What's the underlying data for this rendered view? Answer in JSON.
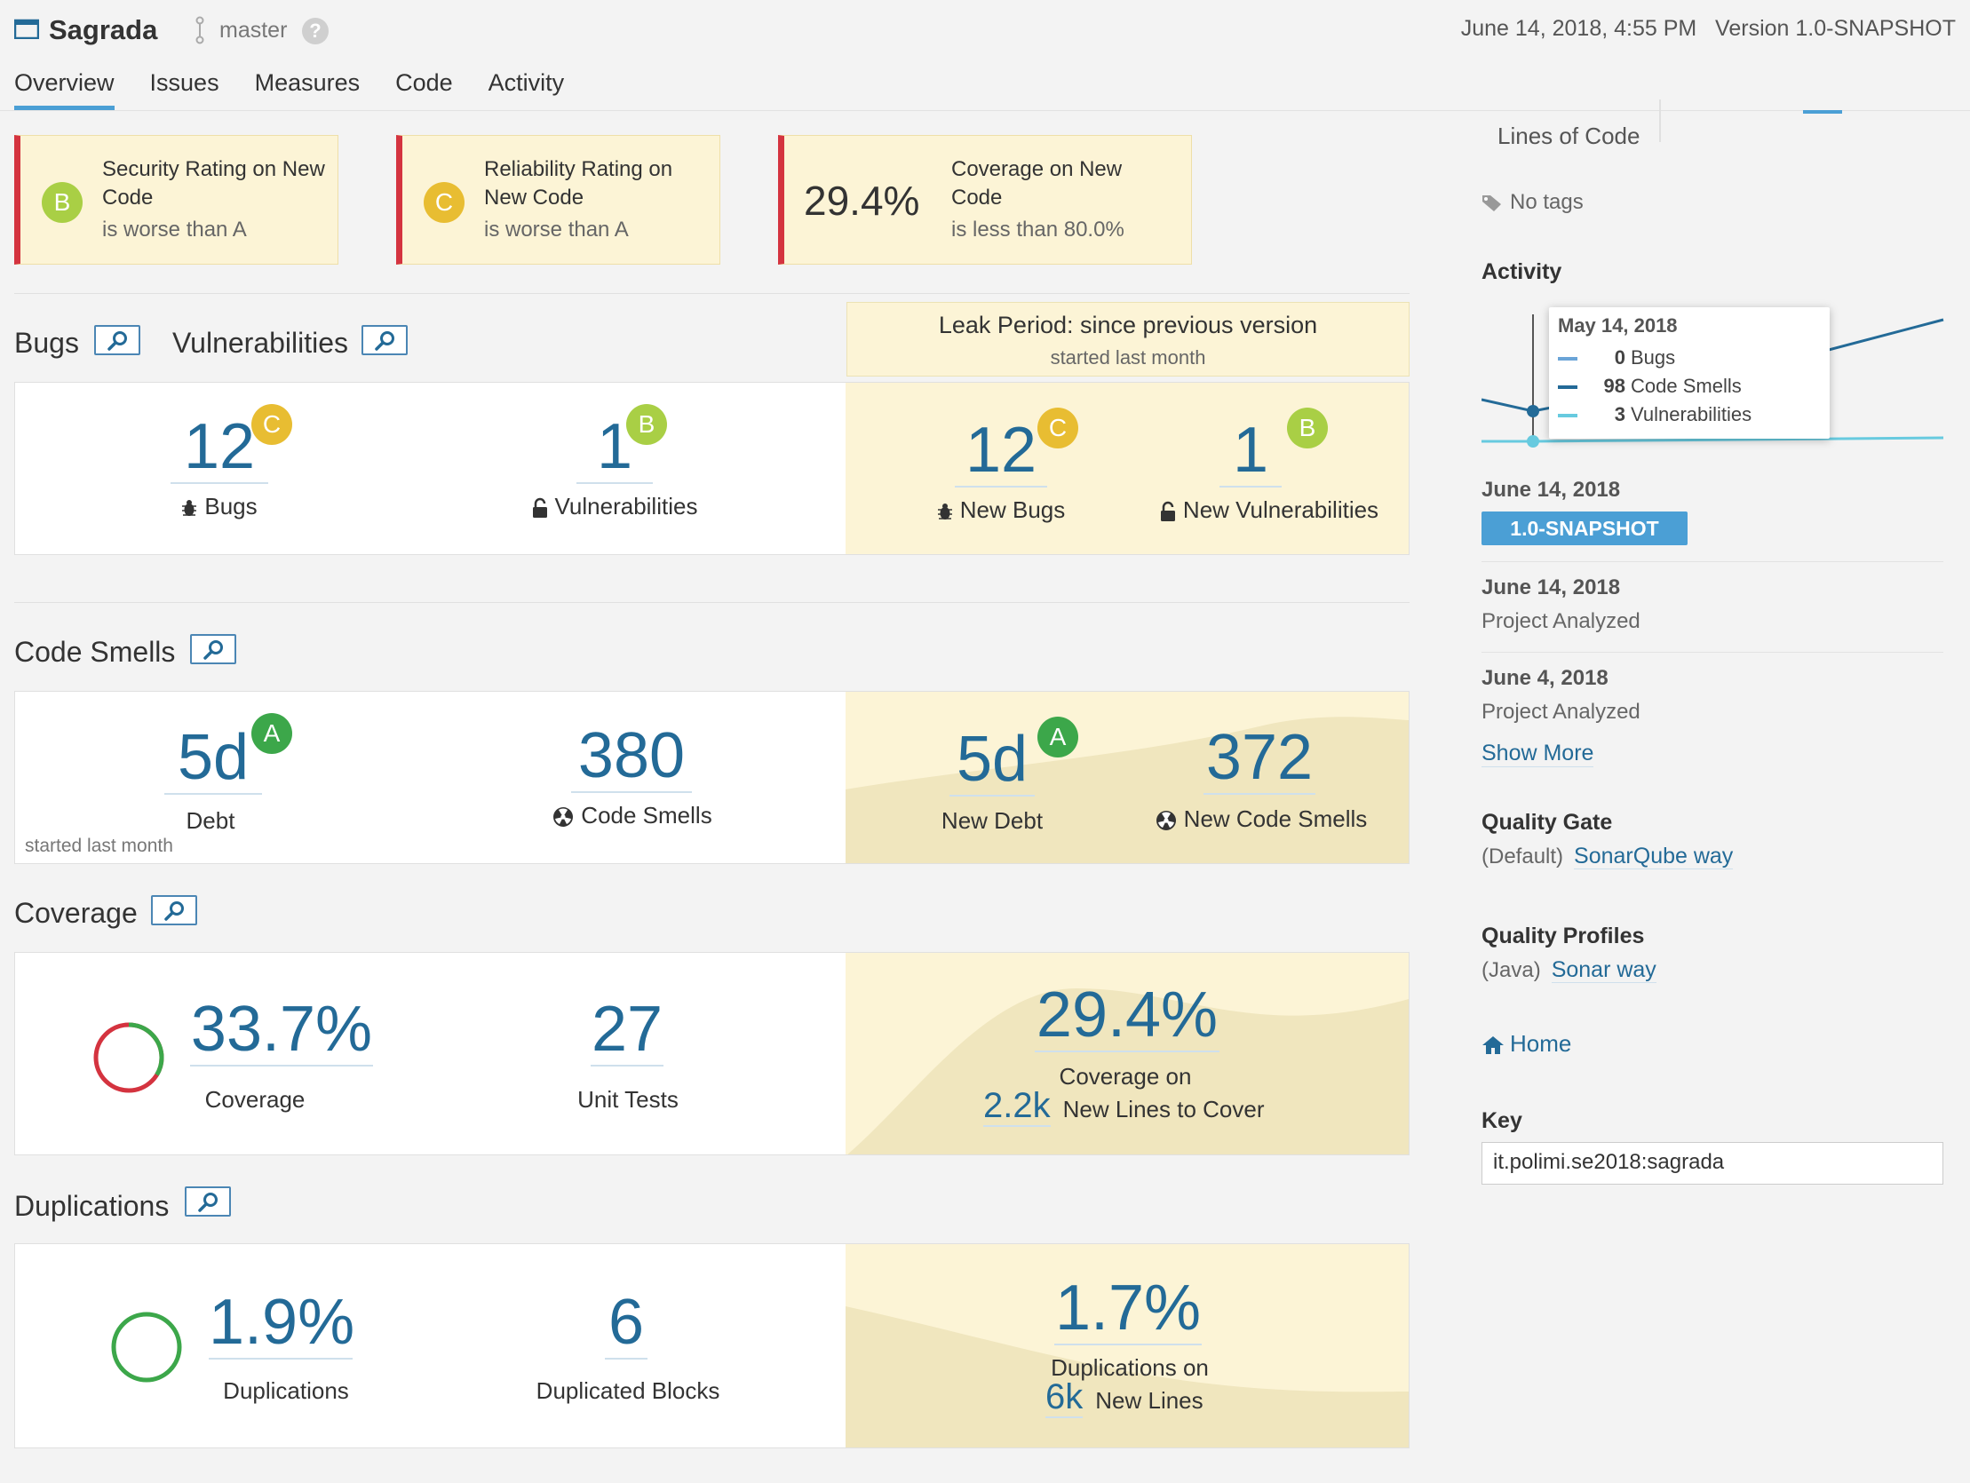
{
  "header": {
    "project_name": "Sagrada",
    "branch": "master",
    "help": "?",
    "date_version": "June 14, 2018, 4:55 PM   Version 1.0-SNAPSHOT"
  },
  "nav": {
    "tabs": [
      "Overview",
      "Issues",
      "Measures",
      "Code",
      "Activity"
    ],
    "active": "Overview"
  },
  "conditions": [
    {
      "rating": "B",
      "label": "Security Rating on New Code",
      "sub": "is worse than A"
    },
    {
      "rating": "C",
      "label": "Reliability Rating on New Code",
      "sub": "is worse than A"
    },
    {
      "value": "29.4%",
      "label": "Coverage on New Code",
      "sub": "is less than 80.0%"
    }
  ],
  "leak": {
    "title": "Leak Period: since previous version",
    "sub": "started last month"
  },
  "bugs_vulns": {
    "title_bugs": "Bugs",
    "title_vulns": "Vulnerabilities",
    "bugs": {
      "value": "12",
      "rating": "C",
      "label": "Bugs"
    },
    "vulns": {
      "value": "1",
      "rating": "B",
      "label": "Vulnerabilities"
    },
    "new_bugs": {
      "value": "12",
      "rating": "C",
      "label": "New Bugs"
    },
    "new_vulns": {
      "value": "1",
      "rating": "B",
      "label": "New Vulnerabilities"
    }
  },
  "code_smells": {
    "title": "Code Smells",
    "debt": {
      "value": "5d",
      "rating": "A",
      "label": "Debt"
    },
    "started": "started last month",
    "smells": {
      "value": "380",
      "label": "Code Smells"
    },
    "new_debt": {
      "value": "5d",
      "rating": "A",
      "label": "New Debt"
    },
    "new_smells": {
      "value": "372",
      "label": "New Code Smells"
    }
  },
  "coverage": {
    "title": "Coverage",
    "coverage": {
      "value": "33.7%",
      "label": "Coverage",
      "percent": 33.7
    },
    "tests": {
      "value": "27",
      "label": "Unit Tests"
    },
    "new_coverage": {
      "value": "29.4%",
      "label": "Coverage on",
      "lines_value": "2.2k",
      "lines_label": "New Lines to Cover"
    }
  },
  "duplications": {
    "title": "Duplications",
    "dup": {
      "value": "1.9%",
      "label": "Duplications",
      "percent": 1.9
    },
    "blocks": {
      "value": "6",
      "label": "Duplicated Blocks"
    },
    "new_dup": {
      "value": "1.7%",
      "label": "Duplications on",
      "lines_value": "6k",
      "lines_label": "New Lines"
    }
  },
  "sidebar": {
    "loc_label": "Lines of Code",
    "no_tags": "No tags",
    "activity_title": "Activity",
    "tooltip": {
      "date": "May 14, 2018",
      "rows": [
        {
          "num": "0",
          "label": "Bugs",
          "color": "#6aa4d7"
        },
        {
          "num": "98",
          "label": "Code Smells",
          "color": "#236a97"
        },
        {
          "num": "3",
          "label": "Vulnerabilities",
          "color": "#67cadf"
        }
      ]
    },
    "events": [
      {
        "date": "June 14, 2018",
        "version": "1.0-SNAPSHOT"
      },
      {
        "date": "June 14, 2018",
        "text": "Project Analyzed"
      },
      {
        "date": "June 4, 2018",
        "text": "Project Analyzed"
      }
    ],
    "show_more": "Show More",
    "quality_gate": {
      "title": "Quality Gate",
      "prefix": "(Default)",
      "link": "SonarQube way"
    },
    "quality_profiles": {
      "title": "Quality Profiles",
      "prefix": "(Java)",
      "link": "Sonar way"
    },
    "home": "Home",
    "key": {
      "title": "Key",
      "value": "it.polimi.se2018:sagrada"
    }
  },
  "colors": {
    "rating_a": "#3ca74a",
    "rating_b": "#a9cf45",
    "rating_c": "#e8bd32",
    "link": "#236a97",
    "leak_bg": "#fcf4d6",
    "error": "#d4333f"
  }
}
